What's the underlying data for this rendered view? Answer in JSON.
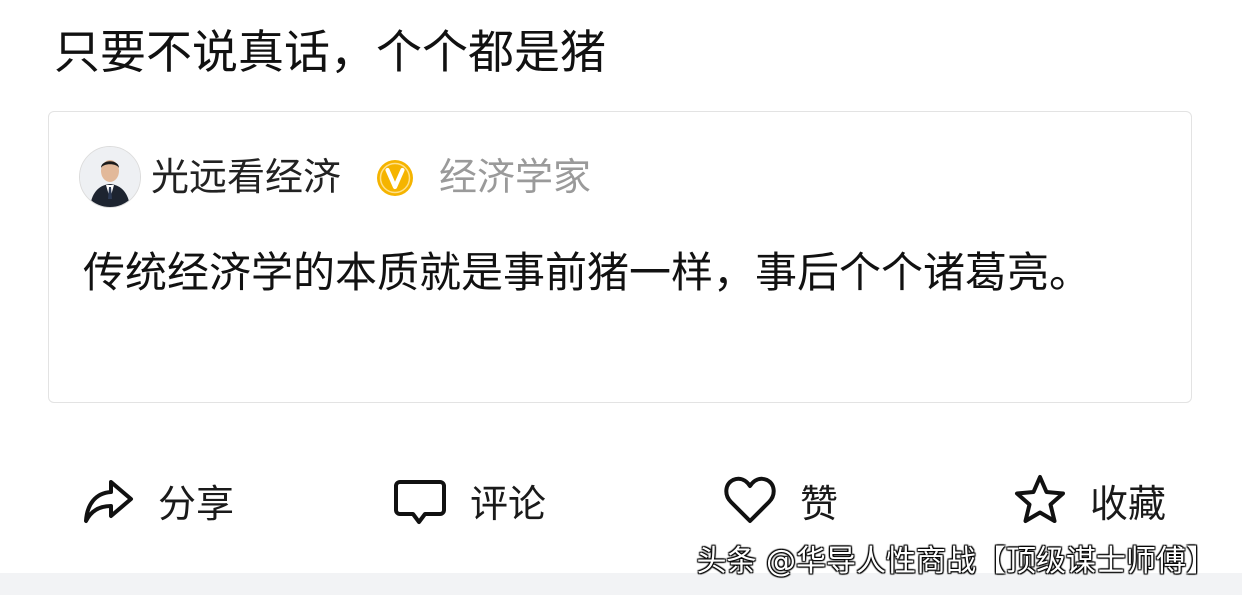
{
  "post": {
    "text": "只要不说真话，个个都是猪"
  },
  "quote": {
    "author": {
      "name": "光远看经济",
      "title": "经济学家",
      "avatar_icon": "avatar-man-in-suit",
      "verified_icon": "verified-v-badge",
      "verified_color": "#f5b400"
    },
    "text": "传统经济学的本质就是事前猪一样，事后个个诸葛亮。"
  },
  "actions": [
    {
      "label": "分享",
      "icon": "share-icon"
    },
    {
      "label": "评论",
      "icon": "comment-icon"
    },
    {
      "label": "赞",
      "icon": "heart-icon"
    },
    {
      "label": "收藏",
      "icon": "star-icon"
    }
  ],
  "watermark": {
    "text": "头条 @华导人性商战【顶级谋士师傅】"
  }
}
